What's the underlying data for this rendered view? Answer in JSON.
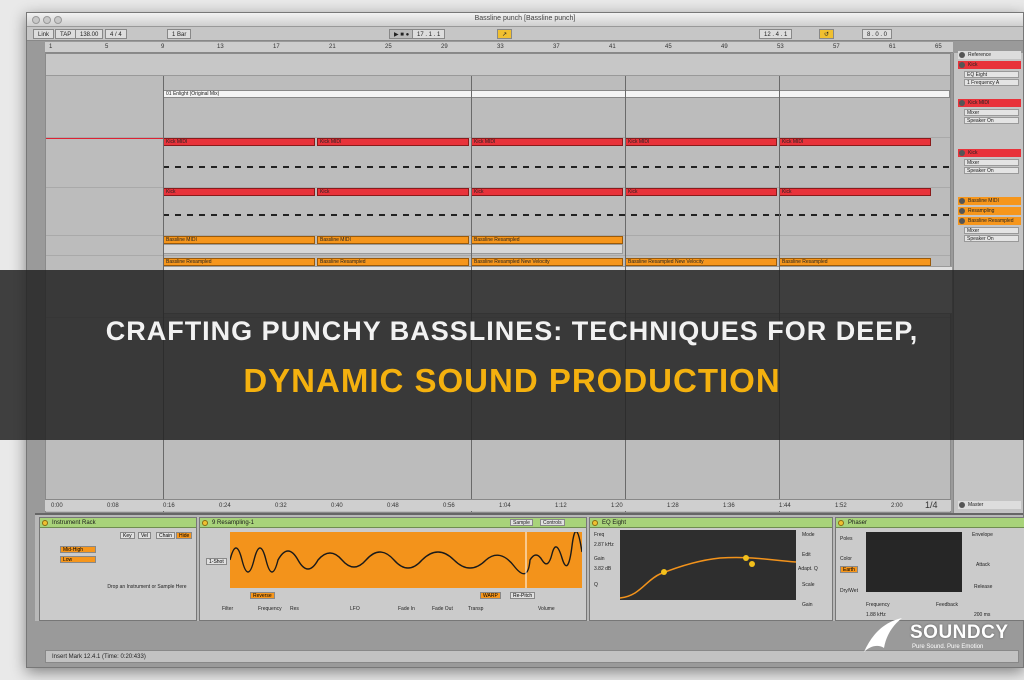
{
  "window": {
    "title": "Bassline punch  [Bassline punch]"
  },
  "control_bar": {
    "link": "Link",
    "tap": "TAP",
    "tempo": "138.00",
    "signature": "4 / 4",
    "quantize": "1 Bar",
    "position": "17 . 1 . 1",
    "loop_start": "12 . 4 . 1",
    "loop_length": "8 . 0 . 0"
  },
  "ruler": {
    "bars": [
      "1",
      "5",
      "9",
      "13",
      "17",
      "21",
      "25",
      "29",
      "33",
      "37",
      "41",
      "45",
      "49",
      "53",
      "57",
      "61",
      "65"
    ]
  },
  "arrangement": {
    "reference_clip": "01 Enlight (Original Mix)",
    "red_clips": [
      "Kick MIDI",
      "Kick MIDI",
      "Kick MIDI",
      "Kick MIDI",
      "Kick MIDI"
    ],
    "red2_clips": [
      "Kick",
      "Kick",
      "Kick",
      "Kick",
      "Kick"
    ],
    "bass_midi_clips": [
      "Bassline MIDI",
      "Bassline MIDI",
      "Bassline Resampled"
    ],
    "resampled_clips": [
      "Bassline Resampled",
      "Bassline Resampled",
      "Bassline Resampled New Velocity",
      "Bassline Resampled New Velocity",
      "Bassline Resampled",
      "Bassline Resampled"
    ]
  },
  "tracks": {
    "reference": "Reference",
    "kick": "Kick",
    "eq": "EQ Eight",
    "freq": "1 Frequency A",
    "kick_midi": "Kick MIDI",
    "mixer": "Mixer",
    "speaker": "Speaker On",
    "kick2": "Kick",
    "bass_midi": "Bassline MIDI",
    "resampling": "Resampling",
    "bass_resampled": "Bassline Resampled",
    "master": "Master",
    "drop_hint": "Drop Files and Devices Here"
  },
  "timeline": {
    "times": [
      "0:00",
      "0:08",
      "0:16",
      "0:24",
      "0:32",
      "0:40",
      "0:48",
      "0:56",
      "1:04",
      "1:12",
      "1:20",
      "1:28",
      "1:36",
      "1:44",
      "1:52",
      "2:00"
    ],
    "page": "1/4"
  },
  "devices": {
    "rack": {
      "title": "Instrument Rack",
      "chain1": "Mid-High",
      "chain2": "Low",
      "drop": "Drop an Instrument or Sample Here",
      "btns": [
        "Key",
        "Vel",
        "Chain",
        "Hide"
      ]
    },
    "sampler": {
      "title": "9 Resampling-1",
      "tab1": "Sample",
      "tab2": "Controls",
      "loop": "1-Shot",
      "rev": "Reverse",
      "warp": "WARP",
      "beats": "Re-Pitch",
      "filter": "Filter",
      "freq": "Frequency",
      "res": "Res",
      "lfo": "LFO",
      "fadein": "Fade In",
      "fadeout": "Fade Out",
      "transp": "Transp",
      "vol": "Volume"
    },
    "eq": {
      "title": "EQ Eight",
      "freq": "Freq",
      "gain": "Gain",
      "q": "Q",
      "mode": "Mode",
      "edit": "Edit",
      "adapt": "Adapt. Q",
      "scale": "Scale",
      "gain_label": "Gain",
      "freq_val": "2.87 kHz",
      "gain_val": "3.82 dB"
    },
    "phaser": {
      "title": "Phaser",
      "poles": "Poles",
      "color": "Color",
      "earth": "Earth",
      "drywet": "Dry/Wet",
      "frequency": "Frequency",
      "feedback": "Feedback",
      "envelope": "Envelope",
      "attack": "Attack",
      "release": "Release",
      "freq_val": "1.88 kHz",
      "release_val": "200 ms"
    }
  },
  "status": {
    "text": "Insert Mark 12.4.1 (Time: 0:20:433)"
  },
  "headline": {
    "line1": "CRAFTING PUNCHY BASSLINES: TECHNIQUES FOR DEEP,",
    "line2": "DYNAMIC SOUND PRODUCTION"
  },
  "brand": {
    "name": "SOUNDCY",
    "tagline": "Pure Sound. Pure Emotion"
  },
  "colors": {
    "red_clip": "#e8323a",
    "orange_clip": "#f6961c",
    "device_header": "#a8d37a",
    "headline_accent": "#f4b10f"
  }
}
